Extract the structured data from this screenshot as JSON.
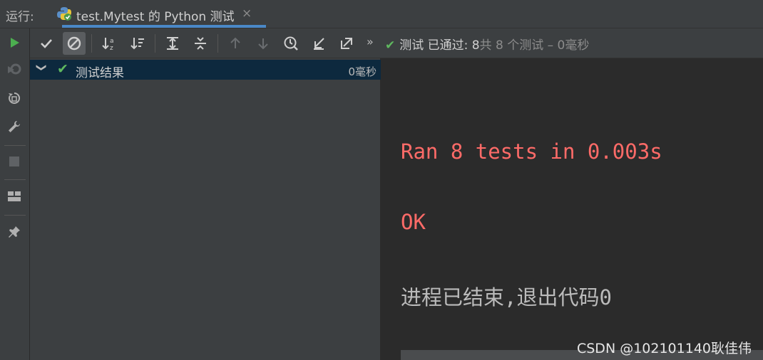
{
  "tabbar": {
    "run_label": "运行:",
    "tab_title": "test.Mytest 的 Python 测试",
    "close_glyph": "×"
  },
  "toolbar": {
    "more_glyph": "»",
    "status_prefix": "测试 已通过: 8",
    "status_suffix": "共 8 个测试 – 0毫秒"
  },
  "tree": {
    "root_label": "测试结果",
    "root_time": "0毫秒"
  },
  "console": {
    "lines": [
      "Ran 8 tests in 0.003s",
      "OK",
      "进程已结束,退出代码0"
    ]
  },
  "watermark": "CSDN @102101140耿佳伟",
  "colors": {
    "success_green": "#5fb85f",
    "error_red": "#ff6b68",
    "selected_row": "#0d293e",
    "tab_underline": "#4a88c7"
  }
}
